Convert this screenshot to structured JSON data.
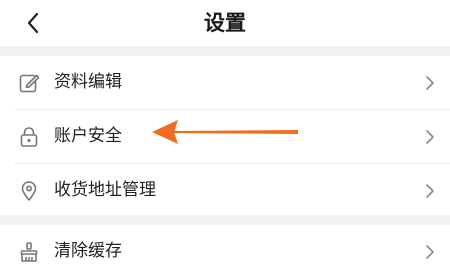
{
  "header": {
    "title": "设置",
    "back_icon": "chevron-left-icon"
  },
  "settings": {
    "group1": [
      {
        "label": "资料编辑",
        "icon": "edit-icon"
      },
      {
        "label": "账户安全",
        "icon": "lock-icon"
      },
      {
        "label": "收货地址管理",
        "icon": "location-pin-icon"
      }
    ],
    "group2": [
      {
        "label": "清除缓存",
        "icon": "broom-icon"
      }
    ]
  },
  "annotation": {
    "arrow_color": "#f46a1f"
  },
  "colors": {
    "background": "#f2f2f2",
    "surface": "#ffffff",
    "icon": "#777777",
    "chevron": "#888888"
  }
}
